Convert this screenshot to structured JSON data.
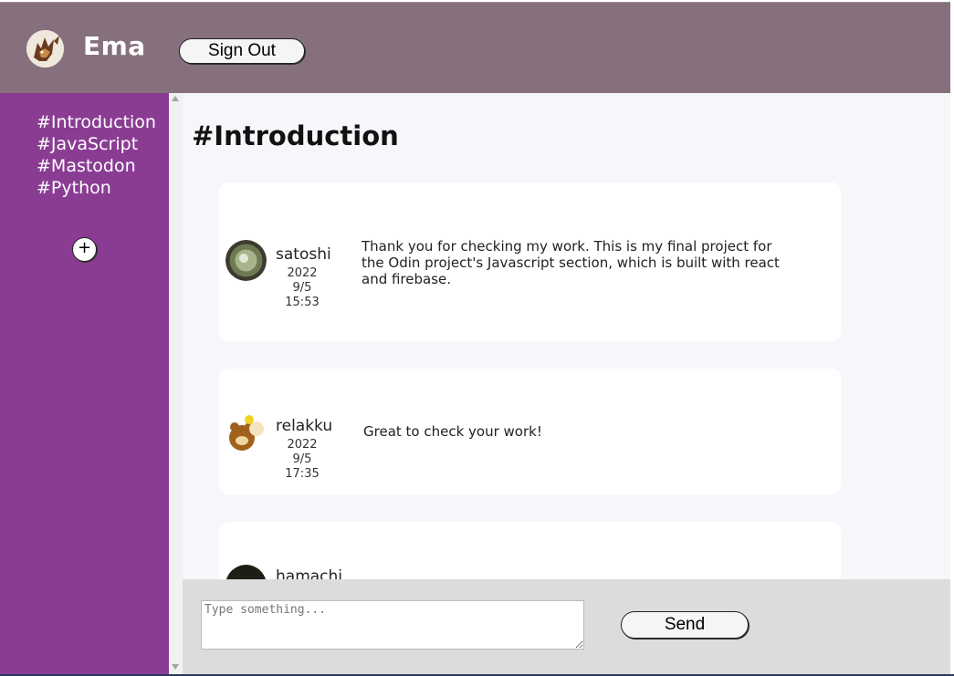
{
  "header": {
    "username": "Ema",
    "sign_out_label": "Sign Out"
  },
  "sidebar": {
    "channels": [
      {
        "label": "#Introduction"
      },
      {
        "label": "#JavaScript"
      },
      {
        "label": "#Mastodon"
      },
      {
        "label": "#Python"
      }
    ],
    "add_label": "+"
  },
  "main": {
    "title": "#Introduction",
    "messages": [
      {
        "author": "satoshi",
        "date": "2022 9/5",
        "time": "15:53",
        "text": "Thank you for checking my work. This is my final project for the Odin project's Javascript section, which is built with react and firebase."
      },
      {
        "author": "relakku",
        "date": "2022 9/5",
        "time": "17:35",
        "text": "Great to check your work!"
      },
      {
        "author": "hamachi",
        "date": "",
        "time": "",
        "text": ""
      }
    ]
  },
  "composer": {
    "placeholder": "Type something...",
    "send_label": "Send"
  },
  "colors": {
    "header_bg": "#86707d",
    "sidebar_bg": "#8a3c93",
    "main_bg": "#f6f7fb",
    "composer_bg": "#dcdcdc"
  }
}
